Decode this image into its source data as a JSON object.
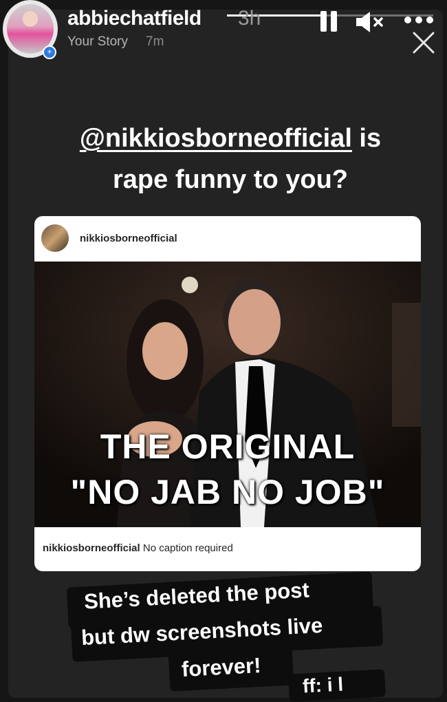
{
  "story": {
    "username": "abbiechatfield",
    "time_ago": "3h",
    "subtitle": "Your Story",
    "subtitle_time": "7m",
    "progress": 0.48
  },
  "controls": {
    "pause_icon": "pause-icon",
    "mute_icon": "mute-icon",
    "more_icon": "more-dots-icon",
    "close_icon": "close-icon"
  },
  "headline": {
    "mention": "@nikkiosborneofficial",
    "line1_suffix": " is",
    "line2": "rape funny to you?"
  },
  "post": {
    "username": "nikkiosborneofficial",
    "image_text_line1": "THE ORIGINAL",
    "image_text_line2": "\"NO JAB NO JOB\"",
    "caption_user": "nikkiosborneofficial",
    "caption_text": " No caption required"
  },
  "sticker": {
    "line1": "She’s deleted the  post",
    "line2": "but dw screenshots live",
    "line3": "forever!",
    "partial": "ff: i l"
  },
  "colors": {
    "background": "#232323",
    "sticker_bg": "#0d0d0d",
    "badge_blue": "#2d7be0"
  }
}
